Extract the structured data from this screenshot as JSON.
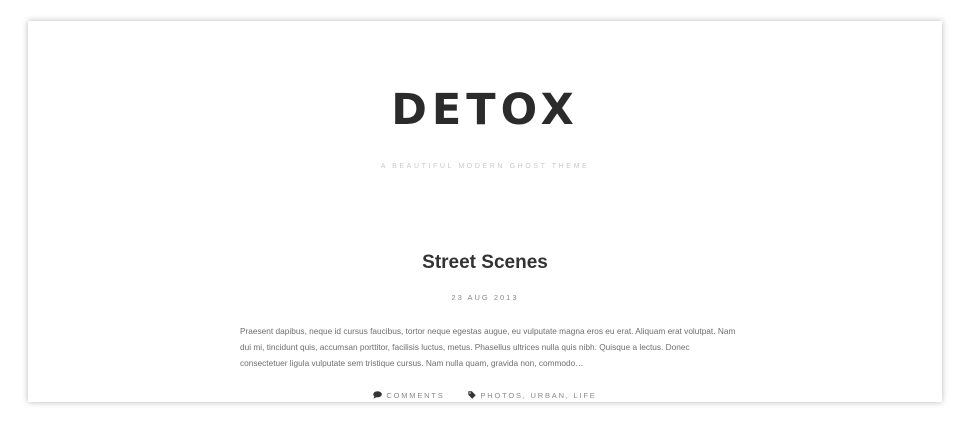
{
  "site": {
    "title": "DETOX",
    "tagline": "A BEAUTIFUL MODERN GHOST THEME"
  },
  "post": {
    "title": "Street Scenes",
    "date": "23 AUG 2013",
    "excerpt": "Praesent dapibus, neque id cursus faucibus, tortor neque egestas augue, eu vulputate magna eros eu erat. Aliquam erat volutpat. Nam dui mi, tincidunt quis, accumsan porttitor, facilisis luctus, metus. Phasellus ultrices nulla quis nibh. Quisque a lectus. Donec consectetuer ligula vulputate sem tristique cursus. Nam nulla quam, gravida non, commodo…",
    "meta": {
      "comments_label": "COMMENTS",
      "comments_icon": "speech-bubble-icon",
      "tags_label": "PHOTOS, URBAN, LIFE",
      "tags_icon": "tag-icon"
    }
  },
  "colors": {
    "title": "#2b2b2b",
    "tagline": "#c9c9c9",
    "text": "#6e6e6e",
    "meta": "#8a8a8a"
  }
}
